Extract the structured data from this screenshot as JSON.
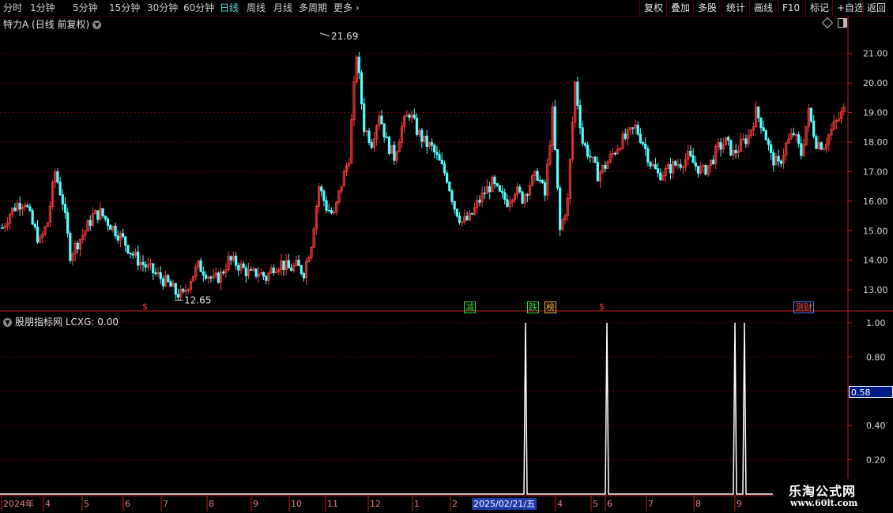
{
  "toolbar": {
    "periods": [
      "分时",
      "1分钟",
      "5分钟",
      "15分钟",
      "30分钟",
      "60分钟",
      "日线",
      "周线",
      "月线",
      "多周期",
      "更多"
    ],
    "active_period": "日线",
    "right_buttons": [
      "复权",
      "叠加",
      "多股",
      "统计",
      "画线",
      "F10",
      "标记",
      "+自选",
      "返回"
    ]
  },
  "main": {
    "title": "特力A (日线 前复权)",
    "high_label": "21.69",
    "low_label": "12.65"
  },
  "sub": {
    "title": "股朋指标网 LCXG: 0.00",
    "current_value": "0.58"
  },
  "badges": [
    {
      "text": "$",
      "color": "#ff3b3b"
    },
    {
      "text": "减",
      "color": "#3adb3a"
    },
    {
      "text": "跌",
      "color": "#3adb3a"
    },
    {
      "text": "榜",
      "color": "#ffb347"
    },
    {
      "text": "$",
      "color": "#ff3b3b"
    },
    {
      "text": "测财",
      "color": "#ff5a5a"
    }
  ],
  "date_axis": {
    "labels": [
      "2024年",
      "4",
      "5",
      "6",
      "7",
      "8",
      "9",
      "10",
      "11",
      "12",
      "1",
      "2",
      "4",
      "5",
      "6",
      "7",
      "8",
      "9"
    ],
    "highlight": "2025/02/21/五"
  },
  "watermark": {
    "line1": "乐淘公式网",
    "line2": "www.60lt.com"
  },
  "colors": {
    "up": "#ff3b3b",
    "down": "#54ffff",
    "grid": "#6a0000",
    "axis": "#c02020",
    "indicator": "#ffffff",
    "background": "#000000"
  },
  "chart_data": [
    {
      "type": "candlestick",
      "yaxis_ticks": [
        13.0,
        14.0,
        15.0,
        16.0,
        17.0,
        18.0,
        19.0,
        20.0,
        21.0
      ],
      "ylim": [
        12.55,
        21.9
      ],
      "series_close": [
        15.1,
        15.6,
        15.9,
        16.0,
        15.2,
        14.6,
        15.3,
        17.0,
        16.0,
        14.2,
        14.6,
        15.0,
        15.5,
        15.6,
        15.3,
        15.0,
        14.7,
        14.3,
        14.0,
        13.8,
        13.6,
        13.4,
        13.2,
        12.9,
        12.8,
        13.4,
        13.8,
        13.6,
        13.3,
        13.5,
        14.0,
        13.9,
        13.7,
        13.5,
        13.6,
        13.4,
        13.8,
        13.9,
        13.7,
        13.8,
        13.6,
        14.6,
        16.5,
        15.8,
        15.5,
        16.6,
        17.5,
        21.0,
        18.5,
        18.0,
        19.0,
        18.0,
        17.5,
        18.5,
        19.0,
        18.4,
        18.0,
        17.8,
        17.3,
        16.8,
        15.8,
        15.3,
        15.4,
        15.9,
        16.3,
        16.6,
        16.2,
        16.0,
        16.4,
        16.1,
        16.6,
        16.9,
        16.2,
        19.0,
        15.0,
        16.0,
        20.0,
        18.0,
        17.5,
        16.9,
        17.2,
        17.6,
        18.0,
        18.2,
        18.5,
        18.0,
        17.3,
        16.9,
        17.0,
        17.2,
        17.3,
        17.5,
        17.2,
        17.0,
        17.3,
        17.8,
        18.0,
        17.6,
        17.9,
        18.2,
        19.0,
        18.5,
        17.5,
        17.2,
        17.9,
        18.3,
        17.6,
        19.0,
        18.0,
        17.9,
        18.4,
        18.8,
        19.2
      ],
      "annotations": [
        {
          "label": "21.69",
          "value": 21.69
        },
        {
          "label": "12.65",
          "value": 12.65
        }
      ]
    },
    {
      "type": "line",
      "series": [
        {
          "name": "LCXG",
          "points": [
            [
              0,
              0
            ],
            [
              663,
              0
            ],
            [
              665,
              1.0
            ],
            [
              667,
              0
            ],
            [
              766,
              0
            ],
            [
              768,
              1.0
            ],
            [
              770,
              0
            ],
            [
              928,
              0
            ],
            [
              930,
              1.0
            ],
            [
              932,
              0
            ],
            [
              940,
              0
            ],
            [
              942,
              1.0
            ],
            [
              944,
              0
            ],
            [
              978,
              0
            ]
          ]
        }
      ],
      "yaxis_ticks": [
        0.2,
        0.4,
        0.6,
        0.8,
        1.0
      ],
      "ylim": [
        0,
        1.05
      ]
    }
  ]
}
